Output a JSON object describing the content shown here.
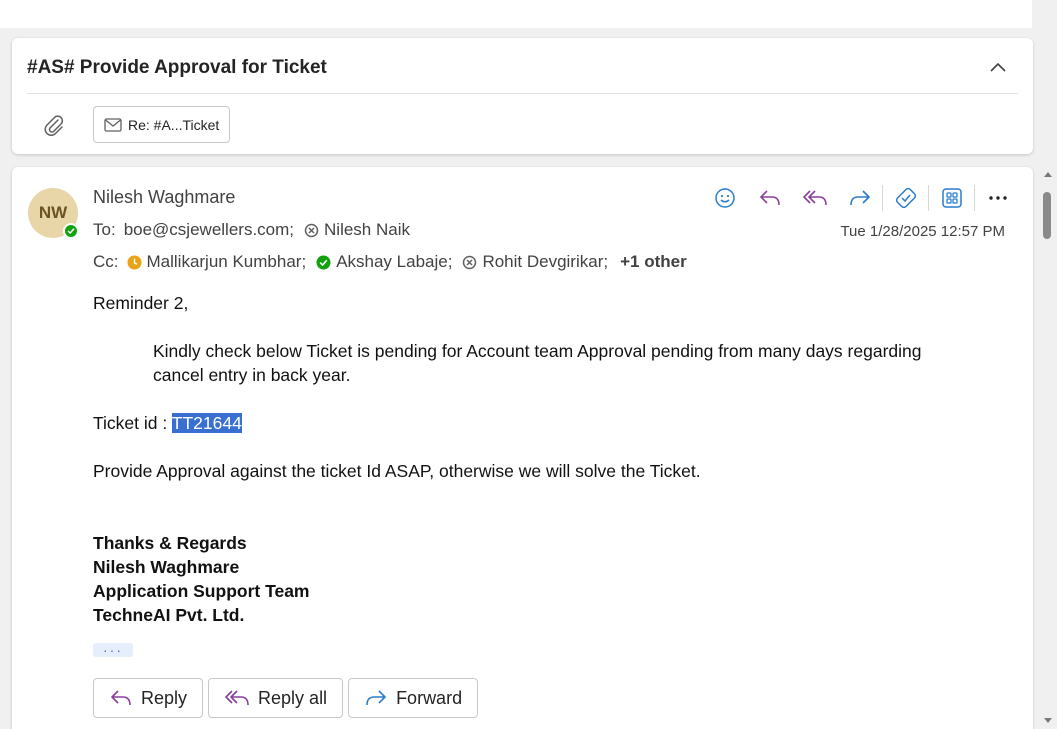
{
  "thread": {
    "subject": "#AS# Provide Approval for Ticket",
    "attachment_chip_label": "Re: #A...Ticket"
  },
  "message": {
    "avatar_initials": "NW",
    "sender_name": "Nilesh Waghmare",
    "to_label": "To:",
    "to": [
      {
        "name": "boe@csjewellers.com;",
        "status": "none"
      },
      {
        "name": "Nilesh Naik",
        "status": "unknown"
      }
    ],
    "cc_label": "Cc:",
    "cc": [
      {
        "name": "Mallikarjun Kumbhar;",
        "status": "away"
      },
      {
        "name": "Akshay Labaje;",
        "status": "available"
      },
      {
        "name": "Rohit Devgirikar;",
        "status": "unknown"
      }
    ],
    "cc_more": "+1 other",
    "timestamp": "Tue 1/28/2025 12:57 PM",
    "body": {
      "greeting": "Reminder 2,",
      "paragraph": "Kindly check below Ticket is pending for Account team Approval pending from many days regarding cancel entry in back year.",
      "ticket_label": "Ticket id : ",
      "ticket_id": "TT21644",
      "request": "Provide Approval against the ticket Id ASAP, otherwise we will solve the Ticket.",
      "signature": [
        "Thanks & Regards",
        "Nilesh Waghmare",
        "Application Support Team",
        "TechneAI Pvt. Ltd."
      ]
    },
    "show_more": "···",
    "reply_buttons": {
      "reply": "Reply",
      "reply_all": "Reply all",
      "forward": "Forward"
    }
  },
  "colors": {
    "accent_blue": "#2a7dc9",
    "reply_purple": "#8a3f9e",
    "available_green": "#13a10e",
    "away_yellow": "#e8a317",
    "highlight_blue": "#3a6fd2"
  },
  "icons": [
    "paperclip-icon",
    "mail-icon",
    "chevron-up-icon",
    "emoji-icon",
    "reply-icon",
    "reply-all-icon",
    "forward-icon",
    "sticky-note-icon",
    "apps-icon",
    "more-icon"
  ]
}
